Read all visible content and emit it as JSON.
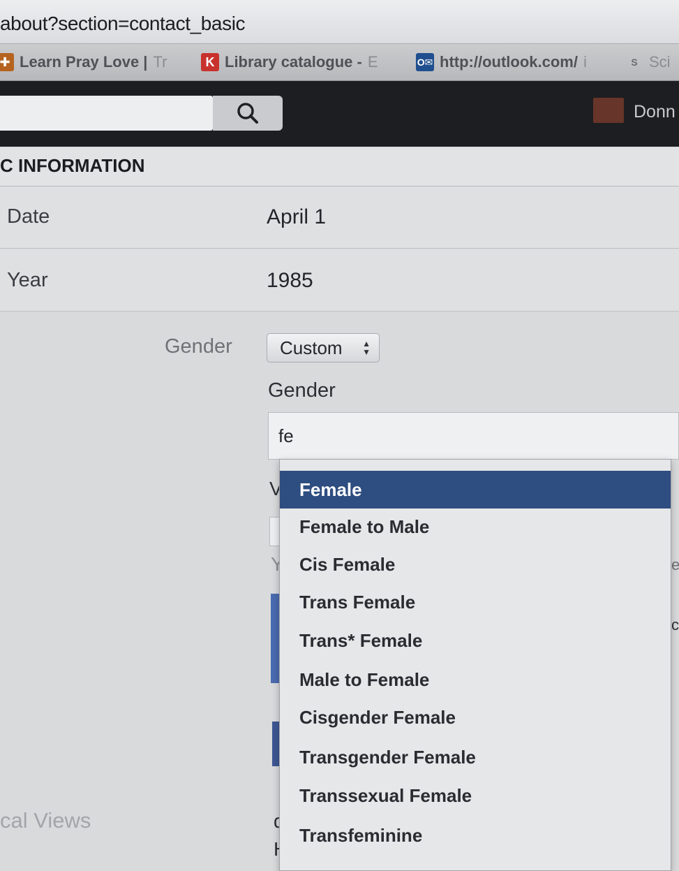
{
  "browser": {
    "url": "about?section=contact_basic",
    "bookmarks": [
      {
        "label": "Learn Pray Love | ",
        "fade": "Tr",
        "icon": "bookmark-arrow-icon"
      },
      {
        "label": "Library catalogue - ",
        "fade": "E",
        "icon": "library-k-icon"
      },
      {
        "label": "http://outlook.com/",
        "fade": "i",
        "icon": "outlook-icon"
      },
      {
        "label": "Sci",
        "fade": "",
        "icon": "sciencedirect-icon"
      }
    ]
  },
  "header": {
    "profile_name": "Donn"
  },
  "section": {
    "title": "C INFORMATION"
  },
  "rows": [
    {
      "label": "Date",
      "value": "April 1"
    },
    {
      "label": "Year",
      "value": "1985"
    }
  ],
  "gender": {
    "label": "Gender",
    "select_value": "Custom",
    "sublabel": "Gender",
    "input_value": "fe"
  },
  "peeks": {
    "w": "V",
    "y": "Y",
    "d": "d",
    "h": "H",
    "e": "e",
    "c": "c"
  },
  "local_views": "cal Views",
  "dropdown": {
    "selected_index": 0,
    "items": [
      "Female",
      "Female to Male",
      "Cis Female",
      "Trans Female",
      "Trans* Female",
      "Male to Female",
      "Cisgender Female",
      "Transgender Female",
      "Transsexual Female",
      "Transfeminine"
    ]
  },
  "colors": {
    "selected_bg": "#2e4d80",
    "header_bg": "#1d1e22",
    "accent_blue": "#4a6bb0"
  }
}
